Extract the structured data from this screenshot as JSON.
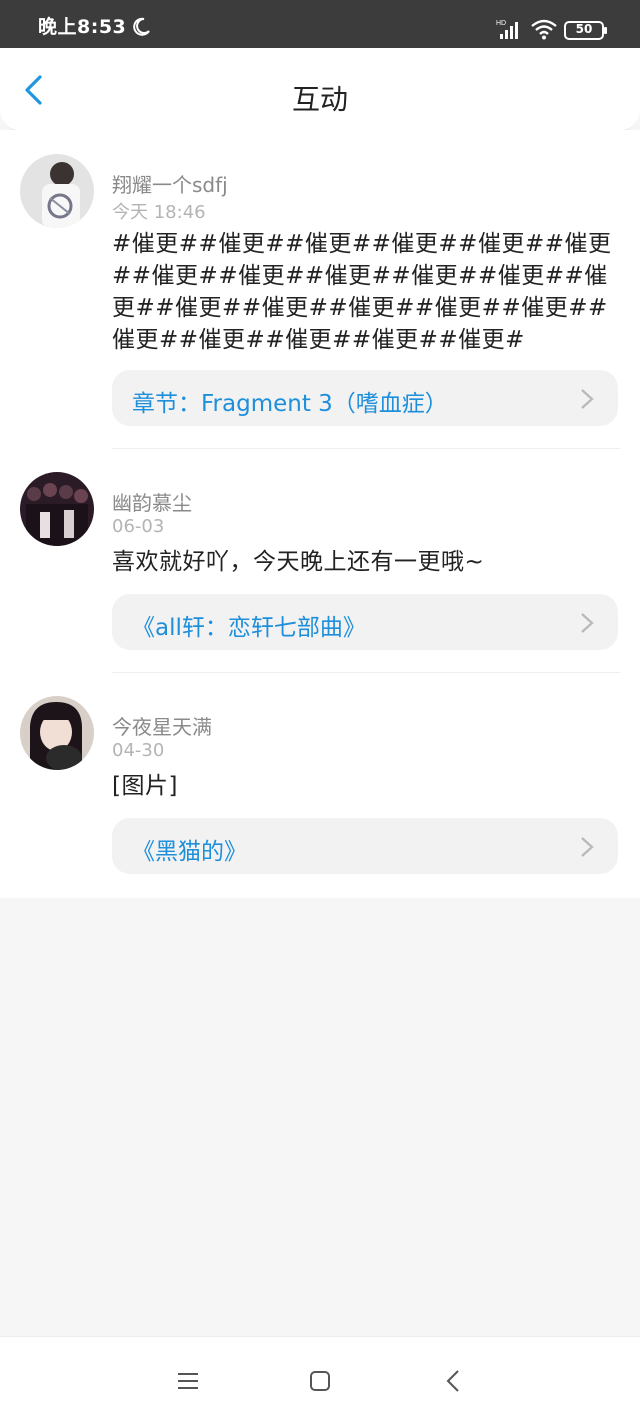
{
  "status_bar": {
    "time": "晚上8:53",
    "battery": "50"
  },
  "header": {
    "title": "互动"
  },
  "comments": [
    {
      "username": "翔耀一个sdfj",
      "time": "今天 18:46",
      "text": "#催更##催更##催更##催更##催更##催更##催更##催更##催更##催更##催更##催更##催更##催更##催更##催更##催更##催更##催更##催更##催更##催更#",
      "chapter": "章节：Fragment 3（嗜血症）"
    },
    {
      "username": "幽韵慕尘",
      "time": "06-03",
      "text": "喜欢就好吖，今天晚上还有一更哦~",
      "chapter": "《all轩：恋轩七部曲》"
    },
    {
      "username": "今夜星天满",
      "time": "04-30",
      "text": "[图片]",
      "chapter": "《黑猫的》"
    }
  ],
  "colors": {
    "accent": "#1e8fdb",
    "status_bar": "#3c3c3c",
    "card_bg": "#f2f2f2",
    "page_bg": "#f7f6f7"
  },
  "icons": {
    "back": "chevron-left-icon",
    "card_arrow": "chevron-right-icon",
    "nav_menu": "menu-icon",
    "nav_home": "home-icon",
    "nav_back": "back-triangle-icon"
  }
}
